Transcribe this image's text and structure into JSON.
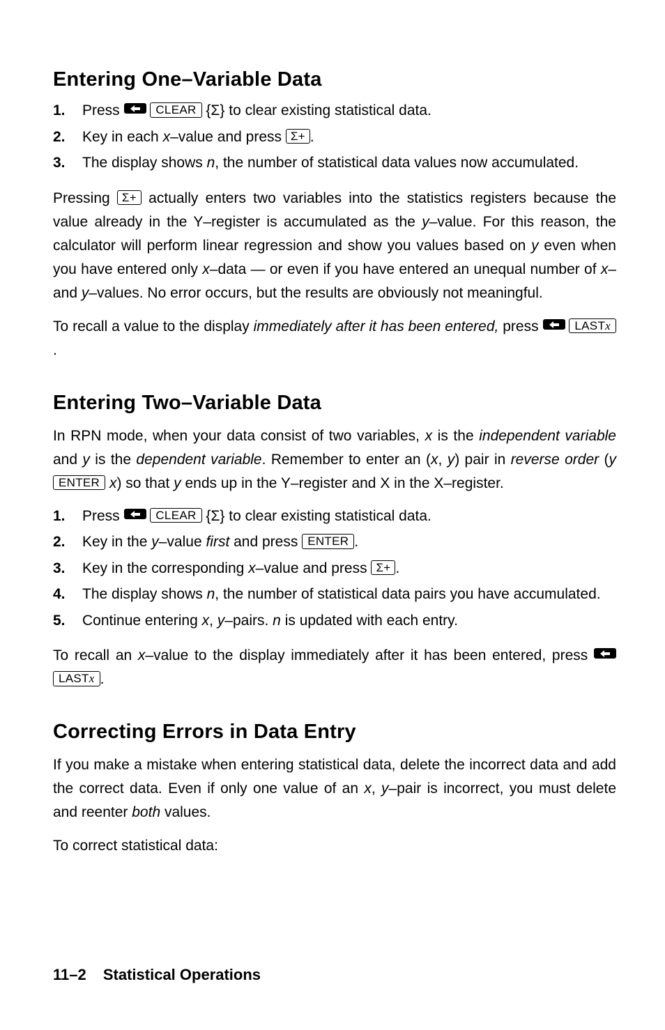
{
  "keys": {
    "clear": "CLEAR",
    "sigmaPlus": "Σ+",
    "sigmaBrace": "{Σ}",
    "enter": "ENTER",
    "lastx": "LAST",
    "lastx_x": "x"
  },
  "s1": {
    "heading": "Entering One–Variable Data",
    "i1_a": "Press ",
    "i1_b": " to clear existing statistical data.",
    "i2_a": "Key in each ",
    "i2_b": "x",
    "i2_c": "–value and press ",
    "i3_a": "The display shows ",
    "i3_b": "n",
    "i3_c": ", the number of statistical data values now accumulated.",
    "p1_a": "Pressing ",
    "p1_b": " actually enters two variables into the statistics registers because the value already in the Y–register is accumulated as the ",
    "p1_c": "y",
    "p1_d": "–value. For this reason, the calculator will perform linear regression and show you values based on ",
    "p1_e": "y",
    "p1_f": " even when you have entered only ",
    "p1_g": "x",
    "p1_h": "–data — or even if you have entered an unequal number of ",
    "p1_i": "x",
    "p1_j": "–and ",
    "p1_k": "y",
    "p1_l": "–values. No error occurs, but the results are obviously not meaningful.",
    "p2_a": "To recall a value to the display ",
    "p2_b": "immediately after it has been entered,",
    "p2_c": " press "
  },
  "s2": {
    "heading": "Entering Two–Variable Data",
    "p1_a": "In RPN mode, when your data consist of two variables, ",
    "p1_b": "x",
    "p1_c": " is the ",
    "p1_d": "independent variable",
    "p1_e": " and ",
    "p1_f": "y",
    "p1_g": " is the ",
    "p1_h": "dependent variable",
    "p1_i": ". Remember to enter an (",
    "p1_j": "x",
    "p1_k": ", ",
    "p1_l": "y",
    "p1_m": ") pair in ",
    "p1_n": "reverse order",
    "p1_o": " (",
    "p1_p": "y",
    "p1_q": " ",
    "p1_r": " ",
    "p1_s": "x",
    "p1_t": ") so that ",
    "p1_u": "y",
    "p1_v": " ends up in the Y–register and X in the X–register.",
    "i1_a": "Press ",
    "i1_b": " to clear existing statistical data.",
    "i2_a": "Key in the ",
    "i2_b": "y",
    "i2_c": "–value ",
    "i2_d": "first",
    "i2_e": " and press ",
    "i3_a": "Key in the corresponding ",
    "i3_b": "x",
    "i3_c": "–value and press ",
    "i4_a": "The display shows ",
    "i4_b": "n",
    "i4_c": ", the number of statistical data pairs you have accumulated.",
    "i5_a": "Continue entering ",
    "i5_b": "x",
    "i5_c": ", ",
    "i5_d": "y",
    "i5_e": "–pairs. ",
    "i5_f": "n",
    "i5_g": " is updated with each entry.",
    "p2_a": "To recall an ",
    "p2_b": "x",
    "p2_c": "–value to the display immediately after it has been entered, press "
  },
  "s3": {
    "heading": "Correcting Errors in Data Entry",
    "p1_a": "If you make a mistake when entering statistical data, delete the incorrect data and add the correct data. Even if only one value of an ",
    "p1_b": "x",
    "p1_c": ", ",
    "p1_d": "y",
    "p1_e": "–pair is incorrect, you must delete and reenter ",
    "p1_f": "both",
    "p1_g": " values.",
    "p2": "To correct statistical data:"
  },
  "footer": {
    "page": "11–2",
    "chapter": "Statistical Operations"
  },
  "nums": {
    "n1": "1.",
    "n2": "2.",
    "n3": "3.",
    "n4": "4.",
    "n5": "5."
  },
  "period": "."
}
